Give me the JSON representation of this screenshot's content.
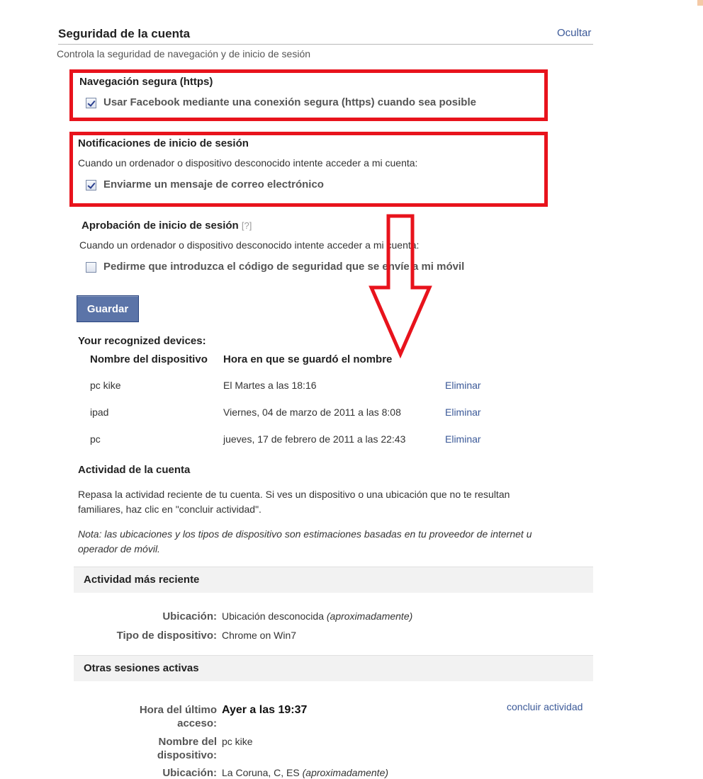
{
  "header": {
    "title": "Seguridad de la cuenta",
    "hide_link": "Ocultar",
    "subtitle": "Controla la seguridad de navegación y de inicio de sesión"
  },
  "secure_browsing": {
    "title": "Navegación segura (https)",
    "checkbox_label": "Usar Facebook mediante una conexión segura (https) cuando sea posible",
    "checked": true
  },
  "login_notifications": {
    "title": "Notificaciones de inicio de sesión",
    "description": "Cuando un ordenador o dispositivo desconocido intente acceder a mi cuenta:",
    "checkbox_label": "Enviarme un mensaje de correo electrónico",
    "checked": true
  },
  "login_approval": {
    "title": "Aprobación de inicio de sesión",
    "help": "[?]",
    "description": "Cuando un ordenador o dispositivo desconocido intente acceder a mi cuenta:",
    "checkbox_label": "Pedirme que introduzca el código de seguridad que se envíe a mi móvil",
    "checked": false
  },
  "save_button": "Guardar",
  "devices": {
    "title": "Your recognized devices:",
    "columns": [
      "Nombre del dispositivo",
      "Hora en que se guardó el nombre"
    ],
    "rows": [
      {
        "name": "pc kike",
        "time": "El Martes a las 18:16",
        "action": "Eliminar"
      },
      {
        "name": "ipad",
        "time": "Viernes, 04 de marzo de 2011 a las 8:08",
        "action": "Eliminar"
      },
      {
        "name": "pc",
        "time": "jueves, 17 de febrero de 2011 a las 22:43",
        "action": "Eliminar"
      }
    ]
  },
  "activity": {
    "title": "Actividad de la cuenta",
    "desc_line1": "Repasa la actividad reciente de tu cuenta. Si ves un dispositivo o una ubicación que no te resultan",
    "desc_line2": "familiares, haz clic en \"concluir actividad\".",
    "note_line1": "Nota: las ubicaciones y los tipos de dispositivo son estimaciones basadas en tu proveedor de internet u",
    "note_line2": "operador de móvil.",
    "recent": {
      "title": "Actividad más reciente",
      "location_label": "Ubicación:",
      "location_value": "Ubicación desconocida",
      "location_approx": "(aproximadamente)",
      "device_label": "Tipo de dispositivo:",
      "device_value": "Chrome on Win7"
    },
    "other": {
      "title": "Otras sesiones activas",
      "last_access_label_1": "Hora del último",
      "last_access_label_2": "acceso:",
      "last_access_value": "Ayer a las 19:37",
      "end_link": "concluir actividad",
      "device_name_label_1": "Nombre del",
      "device_name_label_2": "dispositivo:",
      "device_name_value": "pc kike",
      "location_label": "Ubicación:",
      "location_value": "La Coruna, C, ES",
      "location_approx": "(aproximadamente)"
    }
  },
  "colors": {
    "highlight_red": "#e8131c",
    "link_blue": "#3b5998",
    "button_blue": "#5b74a8"
  }
}
